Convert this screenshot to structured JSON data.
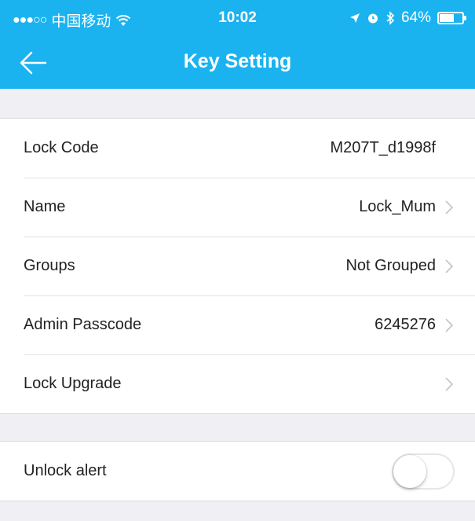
{
  "status_bar": {
    "carrier": "中国移动",
    "time": "10:02",
    "battery": "64%",
    "battery_level": 0.64
  },
  "navbar": {
    "title": "Key Setting",
    "back_icon": "arrow-left-icon"
  },
  "colors": {
    "accent": "#1ab3f0",
    "background": "#efeff4"
  },
  "settings": [
    {
      "label": "Lock Code",
      "value": "M207T_d1998f",
      "chevron": false
    },
    {
      "label": "Name",
      "value": "Lock_Mum",
      "chevron": true
    },
    {
      "label": "Groups",
      "value": "Not Grouped",
      "chevron": true
    },
    {
      "label": "Admin Passcode",
      "value": "6245276",
      "chevron": true
    },
    {
      "label": "Lock Upgrade",
      "value": "",
      "chevron": true
    }
  ],
  "alerts": {
    "label": "Unlock alert",
    "toggle_on": false
  }
}
